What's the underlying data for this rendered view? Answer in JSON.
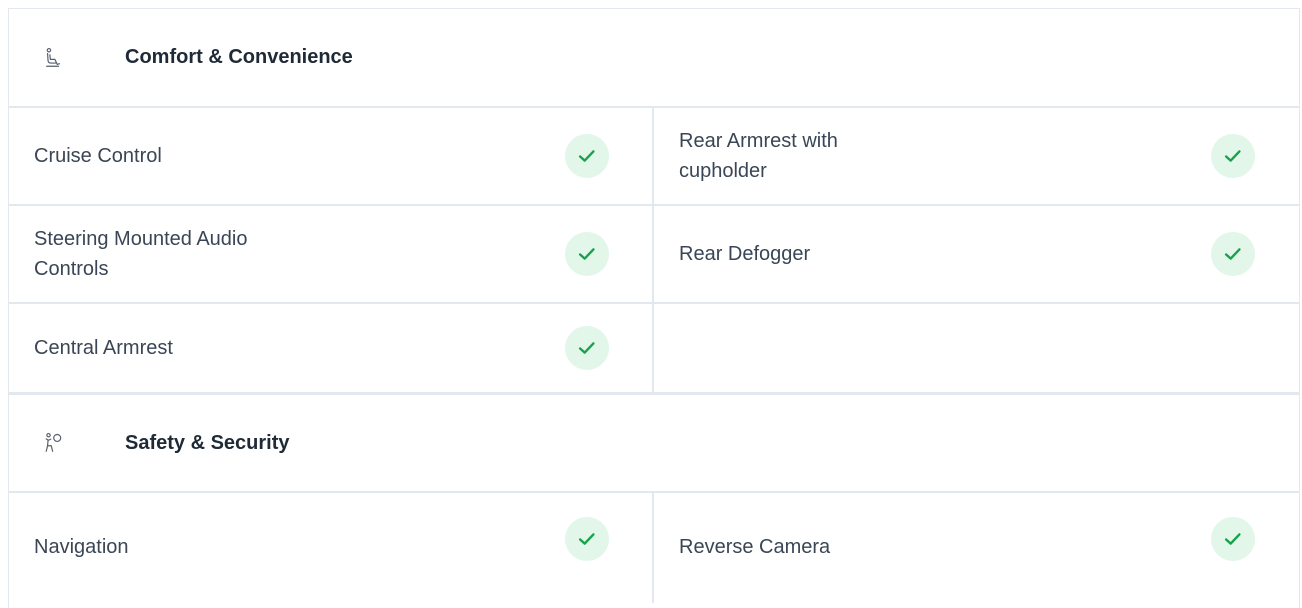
{
  "sections": [
    {
      "title": "Comfort & Convenience",
      "icon": "seat-icon",
      "rows": [
        {
          "left": "Cruise Control",
          "right": "Rear Armrest with cupholder"
        },
        {
          "left": "Steering Mounted Audio Controls",
          "right": "Rear Defogger"
        },
        {
          "left": "Central Armrest",
          "right": ""
        }
      ]
    },
    {
      "title": "Safety & Security",
      "icon": "airbag-icon",
      "rows": [
        {
          "left": "Navigation",
          "right": "Reverse Camera"
        }
      ]
    }
  ],
  "colors": {
    "check_bg": "#e2f6ea",
    "check_mark": "#16a34a",
    "border": "#e3e8ee",
    "title_text": "#1f2a37",
    "body_text": "#3a4656"
  }
}
